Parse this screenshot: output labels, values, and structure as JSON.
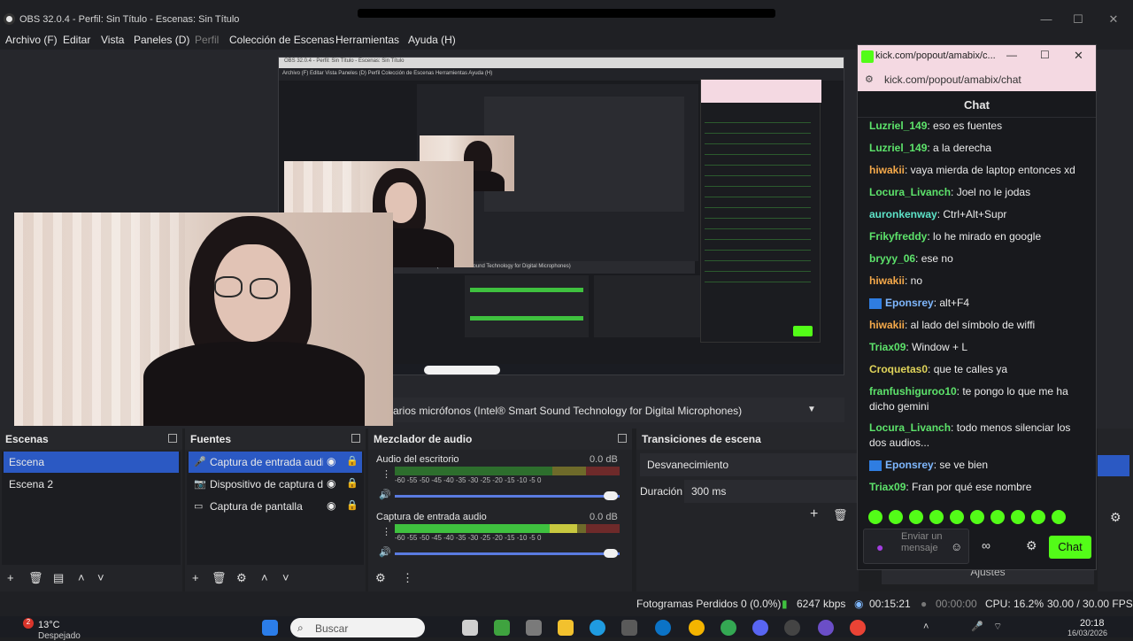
{
  "window": {
    "title": "OBS 32.0.4 - Perfil: Sin Título - Escenas: Sin Título"
  },
  "menu": [
    "Archivo (F)",
    "Editar",
    "Vista",
    "Paneles (D)",
    "Perfil",
    "Colección de Escenas",
    "Herramientas",
    "Ayuda (H)"
  ],
  "nested_menu": "Archivo (F)   Editar   Vista   Paneles (D)   Perfil   Colección de Escenas   Herramientas   Ayuda (H)",
  "nested_device": "rios micrófonos (Intel® Smart Sound Technology for Digital Microphones)",
  "device_row": "arios micrófonos (Intel® Smart Sound Technology for Digital Microphones)",
  "docks": {
    "scenes": {
      "title": "Escenas",
      "items": [
        "Escena",
        "Escena 2"
      ]
    },
    "sources": {
      "title": "Fuentes",
      "items": [
        "Captura de entrada audio",
        "Dispositivo de captura de",
        "Captura de pantalla"
      ]
    },
    "mixer": {
      "title": "Mezclador de audio",
      "channels": [
        {
          "name": "Audio del escritorio",
          "db": "0.0 dB",
          "level": 0
        },
        {
          "name": "Captura de entrada audio",
          "db": "0.0 dB",
          "level": 0.81
        }
      ],
      "ticks": "-60   -55   -50   -45   -40   -35   -30   -25   -20   -15   -10   -5   0"
    },
    "transitions": {
      "title": "Transiciones de escena",
      "transition": "Desvanecimiento",
      "duration_label": "Duración",
      "duration_value": "300 ms"
    }
  },
  "controls_fragment": "Ajustes",
  "status": {
    "dropped": "Fotogramas Perdidos 0 (0.0%)",
    "kbps": "6247 kbps",
    "rec_time": "00:15:21",
    "stream_time": "00:00:00",
    "cpu": "CPU: 16.2%",
    "fps": "30.00 / 30.00 FPS"
  },
  "taskbar": {
    "weather_temp": "13°C",
    "weather_desc": "Despejado",
    "weather_badge": "2",
    "search": "Buscar",
    "time": "20:18",
    "date": "16/03/2026"
  },
  "chat": {
    "tab_title": "kick.com/popout/amabix/c...",
    "url": "kick.com/popout/amabix/chat",
    "header": "Chat",
    "messages": [
      {
        "user": "Luzriel_149",
        "text": ": eso es fuentes",
        "color": "#5de36b"
      },
      {
        "user": "Luzriel_149",
        "text": ": a la derecha",
        "color": "#5de36b"
      },
      {
        "user": "hiwakii",
        "text": ": vaya mierda de laptop entonces xd",
        "color": "#f5a94a"
      },
      {
        "user": "Locura_Livanch",
        "text": ": Joel no le jodas",
        "color": "#5de36b"
      },
      {
        "user": "auronkenway",
        "text": ": Ctrl+Alt+Supr",
        "color": "#5de3c8"
      },
      {
        "user": "Frikyfreddy",
        "text": ": lo he mirado en google",
        "color": "#5de36b"
      },
      {
        "user": "bryyy_06",
        "text": ": ese no",
        "color": "#5de36b"
      },
      {
        "user": "hiwakii",
        "text": ": no",
        "color": "#f5a94a"
      },
      {
        "user": "Eponsrey",
        "text": ": alt+F4",
        "color": "#5de36b"
      },
      {
        "user": "hiwakii",
        "text": ": al lado del símbolo de wiffi",
        "color": "#f5a94a"
      },
      {
        "user": "Triax09",
        "text": ": Window + L",
        "color": "#5de36b"
      },
      {
        "user": "Croquetas0",
        "text": ": que te calles ya",
        "color": "#f5a94a"
      },
      {
        "user": "franfushiguroo10",
        "text": ": te pongo lo que me ha dicho gemini",
        "color": "#5de36b"
      },
      {
        "user": "Locura_Livanch",
        "text": ": todo menos silenciar los dos audios...",
        "color": "#5de36b"
      },
      {
        "user": "Eponsrey",
        "text": ": se ve bien",
        "color": "#5de36b"
      },
      {
        "user": "Triax09",
        "text": ": Fran por qué ese nombre",
        "color": "#5de36b"
      }
    ],
    "input_placeholder": "Enviar un mensaje",
    "send_label": "Chat"
  },
  "colors": {
    "accent": "#2b59c3",
    "kick_green": "#53fc18",
    "chat_bg": "#18191d"
  }
}
